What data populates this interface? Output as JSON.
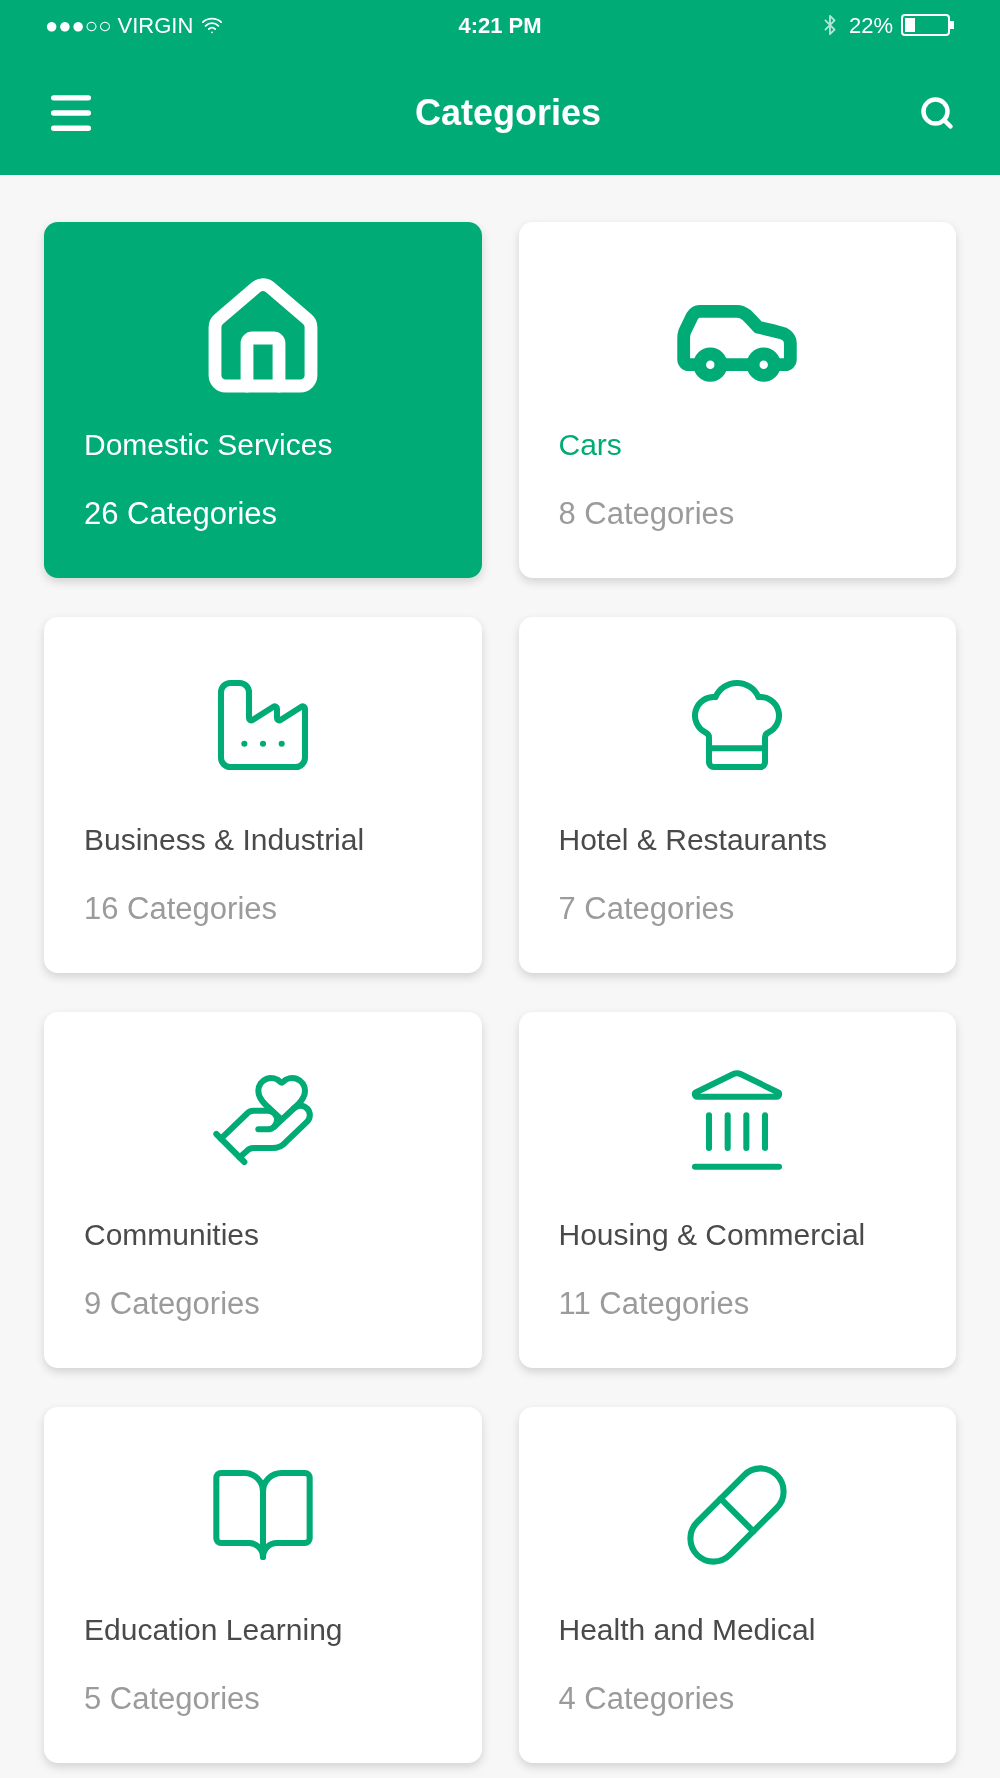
{
  "status_bar": {
    "carrier": "●●●○○ VIRGIN",
    "time": "4:21 PM",
    "battery": "22%"
  },
  "header": {
    "title": "Categories"
  },
  "categories": [
    {
      "title": "Domestic Services",
      "count": "26 Categories",
      "selected": true,
      "accent": false
    },
    {
      "title": "Cars",
      "count": "8 Categories",
      "selected": false,
      "accent": true
    },
    {
      "title": "Business & Industrial",
      "count": "16 Categories",
      "selected": false,
      "accent": false
    },
    {
      "title": "Hotel & Restaurants",
      "count": "7 Categories",
      "selected": false,
      "accent": false
    },
    {
      "title": "Communities",
      "count": "9 Categories",
      "selected": false,
      "accent": false
    },
    {
      "title": "Housing & Commercial",
      "count": "11 Categories",
      "selected": false,
      "accent": false
    },
    {
      "title": "Education Learning",
      "count": "5 Categories",
      "selected": false,
      "accent": false
    },
    {
      "title": "Health and Medical",
      "count": "4 Categories",
      "selected": false,
      "accent": false
    }
  ]
}
